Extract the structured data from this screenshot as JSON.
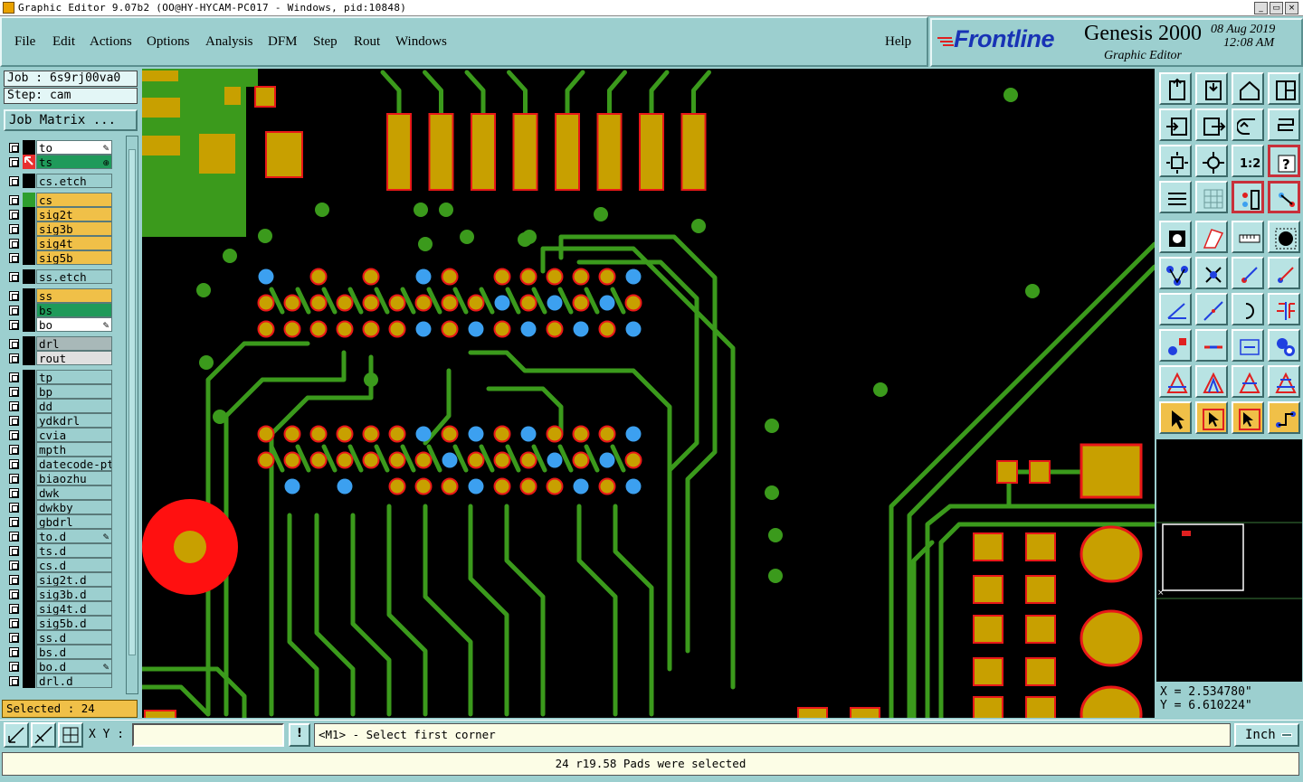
{
  "window": {
    "title": "Graphic Editor 9.07b2 (OO@HY-HYCAM-PC017 - Windows, pid:10848)",
    "buttons": [
      "_",
      "▭",
      "×"
    ]
  },
  "menu": {
    "items": [
      "File",
      "Edit",
      "Actions",
      "Options",
      "Analysis",
      "DFM",
      "Step",
      "Rout",
      "Windows"
    ],
    "help": "Help"
  },
  "logo": {
    "brand": "Frontline",
    "product": "Genesis 2000",
    "subtitle": "Graphic Editor",
    "date": "08 Aug 2019",
    "time": "12:08 AM"
  },
  "job": {
    "job_label": "Job : 6s9rj00va0",
    "step_label": "Step: cam",
    "matrix_button": "Job Matrix ..."
  },
  "layers": [
    {
      "name": "to",
      "color": "#ffffff",
      "ind": "#000000",
      "mark": "✎"
    },
    {
      "name": "ts",
      "color": "#1f9a5a",
      "ind": "#e83030",
      "mark": "⊕",
      "active": true
    },
    {
      "name": "cs.etch",
      "color": "#9ccfcf",
      "ind": "#000000"
    },
    {
      "name": "cs",
      "color": "#f0c048",
      "ind": "#2e9e2e"
    },
    {
      "name": "sig2t",
      "color": "#f0c048",
      "ind": "#000000"
    },
    {
      "name": "sig3b",
      "color": "#f0c048",
      "ind": "#000000"
    },
    {
      "name": "sig4t",
      "color": "#f0c048",
      "ind": "#000000"
    },
    {
      "name": "sig5b",
      "color": "#f0c048",
      "ind": "#000000"
    },
    {
      "name": "ss.etch",
      "color": "#9ccfcf",
      "ind": "#000000"
    },
    {
      "name": "ss",
      "color": "#f0c048",
      "ind": "#000000"
    },
    {
      "name": "bs",
      "color": "#1f9a5a",
      "ind": "#000000"
    },
    {
      "name": "bo",
      "color": "#ffffff",
      "ind": "#000000",
      "mark": "✎"
    },
    {
      "name": "drl",
      "color": "#a8b8b8",
      "ind": "#000000"
    },
    {
      "name": "rout",
      "color": "#e0e0e0",
      "ind": "#000000"
    },
    {
      "name": "tp",
      "color": "#9ccfcf",
      "ind": "#000000"
    },
    {
      "name": "bp",
      "color": "#9ccfcf",
      "ind": "#000000"
    },
    {
      "name": "dd",
      "color": "#9ccfcf",
      "ind": "#000000"
    },
    {
      "name": "ydkdrl",
      "color": "#9ccfcf",
      "ind": "#000000"
    },
    {
      "name": "cvia",
      "color": "#9ccfcf",
      "ind": "#000000"
    },
    {
      "name": "mpth",
      "color": "#9ccfcf",
      "ind": "#000000"
    },
    {
      "name": "datecode-ptc",
      "color": "#9ccfcf",
      "ind": "#000000"
    },
    {
      "name": "biaozhu",
      "color": "#9ccfcf",
      "ind": "#000000"
    },
    {
      "name": "dwk",
      "color": "#9ccfcf",
      "ind": "#000000"
    },
    {
      "name": "dwkby",
      "color": "#9ccfcf",
      "ind": "#000000"
    },
    {
      "name": "gbdrl",
      "color": "#9ccfcf",
      "ind": "#000000"
    },
    {
      "name": "to.d",
      "color": "#9ccfcf",
      "ind": "#000000",
      "mark": "✎"
    },
    {
      "name": "ts.d",
      "color": "#9ccfcf",
      "ind": "#000000"
    },
    {
      "name": "cs.d",
      "color": "#9ccfcf",
      "ind": "#000000"
    },
    {
      "name": "sig2t.d",
      "color": "#9ccfcf",
      "ind": "#000000"
    },
    {
      "name": "sig3b.d",
      "color": "#9ccfcf",
      "ind": "#000000"
    },
    {
      "name": "sig4t.d",
      "color": "#9ccfcf",
      "ind": "#000000"
    },
    {
      "name": "sig5b.d",
      "color": "#9ccfcf",
      "ind": "#000000"
    },
    {
      "name": "ss.d",
      "color": "#9ccfcf",
      "ind": "#000000"
    },
    {
      "name": "bs.d",
      "color": "#9ccfcf",
      "ind": "#000000"
    },
    {
      "name": "bo.d",
      "color": "#9ccfcf",
      "ind": "#000000",
      "mark": "✎"
    },
    {
      "name": "drl.d",
      "color": "#9ccfcf",
      "ind": "#000000"
    }
  ],
  "selected": "Selected : 24",
  "coords": {
    "x": "X = 2.534780\"",
    "y": "Y = 6.610224\""
  },
  "cmd": {
    "xy_label": "X Y :",
    "xy_value": "",
    "bang": "!",
    "prompt": "<M1> - Select first corner",
    "unit": "Inch"
  },
  "status": "24 r19.58 Pads were selected",
  "colors": {
    "background": "#000000",
    "trace": "#3b9a1c",
    "pad_fill": "#c8a000",
    "pad_outline": "#e81818",
    "selected_pad": "#3ca0f0",
    "panel": "#9ccfcf"
  },
  "tools": [
    "tool-1-icon",
    "tool-2-icon",
    "home-icon",
    "tool-4-icon",
    "tool-5-icon",
    "tool-6-icon",
    "undo-icon",
    "tool-8-icon",
    "zoom-fit-icon",
    "zoom-center-icon",
    "scale-1to2-icon",
    "help-icon",
    "settings-icon",
    "grid-icon",
    "layer-red-icon",
    "layer-red2-icon",
    "snap-icon",
    "measure-line-icon",
    "ruler-icon",
    "pad-icon",
    "connect-icon",
    "cross-icon",
    "arrow-dot-icon",
    "arrow-dot2-icon",
    "slope-icon",
    "line-icon",
    "rotate-icon",
    "mirror-icon",
    "pad-select-icon",
    "minus-icon",
    "dimension-icon",
    "group-icon",
    "triangle-icon",
    "triangle2-icon",
    "triangle3-icon",
    "triangle4-icon",
    "pointer-icon",
    "pointer-box-icon",
    "pointer-box2-icon",
    "route-icon"
  ]
}
